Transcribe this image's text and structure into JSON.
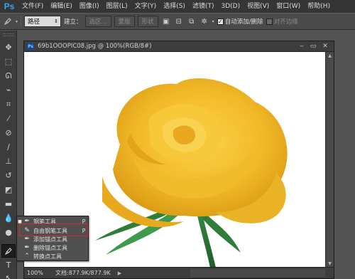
{
  "app": {
    "logo": "Ps",
    "menus": [
      "文件(F)",
      "编辑(E)",
      "图像(I)",
      "图层(L)",
      "文字(Y)",
      "选择(S)",
      "滤镜(T)",
      "3D(D)",
      "视图(V)",
      "窗口(W)",
      "帮助(H)"
    ]
  },
  "options": {
    "mode_value": "路径",
    "make_label": "建立：",
    "selection_btn": "选区...",
    "mask_btn": "蒙版",
    "shape_btn": "形状",
    "auto_add_delete": "自动添加/删除",
    "align_edges": "对齐边缘",
    "auto_add_checked": true
  },
  "document": {
    "title": "69b1OOOPIC08.jpg @ 100%(RGB/8#)",
    "zoom": "100%",
    "doc_info": "文档:877.9K/877.9K"
  },
  "flyout": {
    "items": [
      {
        "label": "钢笔工具",
        "key": "P",
        "icon": "pen-icon",
        "selected": false
      },
      {
        "label": "自由钢笔工具",
        "key": "P",
        "icon": "freeform-pen-icon",
        "selected": true
      },
      {
        "label": "添加锚点工具",
        "key": "",
        "icon": "add-anchor-icon",
        "selected": false
      },
      {
        "label": "删除锚点工具",
        "key": "",
        "icon": "delete-anchor-icon",
        "selected": false
      },
      {
        "label": "转换点工具",
        "key": "",
        "icon": "convert-point-icon",
        "selected": false
      }
    ]
  },
  "colors": {
    "accent": "#3aa3f0",
    "highlight_box": "#d42a2a",
    "rose": "#f2c232",
    "stem": "#2e7d3a"
  }
}
